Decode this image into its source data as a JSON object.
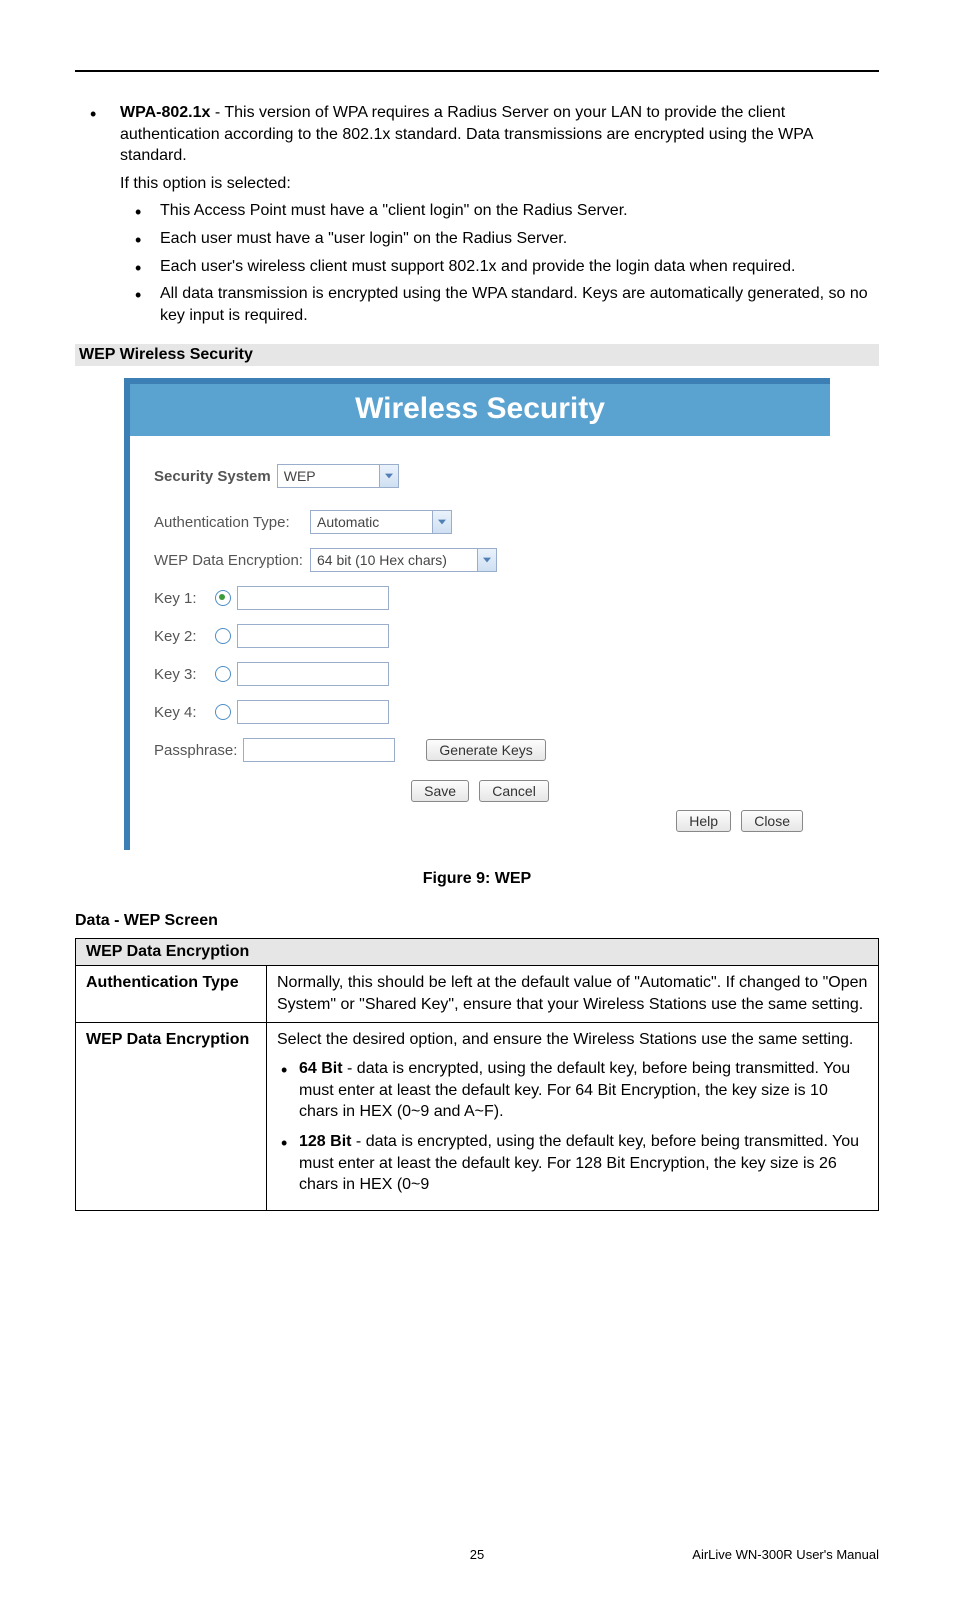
{
  "wpa": {
    "title": "WPA-802.1x",
    "desc": " - This version of WPA requires a Radius Server on your LAN to provide the client authentication according to the 802.1x standard. Data transmissions are encrypted using the WPA standard.",
    "ifselected": "If this option is selected:",
    "items": [
      "This Access Point must have a \"client login\" on the Radius Server.",
      "Each user must have a \"user login\" on the Radius Server.",
      "Each user's wireless client must support 802.1x and provide the login data when required.",
      "All data transmission is encrypted using the WPA standard. Keys are automatically generated, so no key input is required."
    ]
  },
  "section_heading": "WEP Wireless Security",
  "panel": {
    "title": "Wireless Security",
    "security_system_label": "Security System",
    "security_system_value": "WEP",
    "auth_type_label": "Authentication Type:",
    "auth_type_value": "Automatic",
    "wep_enc_label": "WEP Data Encryption:",
    "wep_enc_value": "64 bit (10 Hex chars)",
    "keys": [
      {
        "label": "Key 1:",
        "selected": true
      },
      {
        "label": "Key 2:",
        "selected": false
      },
      {
        "label": "Key 3:",
        "selected": false
      },
      {
        "label": "Key 4:",
        "selected": false
      }
    ],
    "passphrase_label": "Passphrase:",
    "generate_btn": "Generate Keys",
    "save_btn": "Save",
    "cancel_btn": "Cancel",
    "help_btn": "Help",
    "close_btn": "Close"
  },
  "figure_caption": "Figure 9: WEP",
  "table": {
    "heading": "Data - WEP Screen",
    "section_title": "WEP Data Encryption",
    "rows": [
      {
        "label": "Authentication Type",
        "text": "Normally, this should be left at the default value of \"Automatic\". If changed to \"Open System\" or \"Shared Key\", ensure that your Wireless Stations use the same setting."
      },
      {
        "label": "WEP Data Encryption",
        "text": "Select the desired option, and ensure the Wireless Stations use the same setting.",
        "bullets": [
          {
            "bold": "64 Bit",
            "rest": " - data is encrypted, using the default key, before being transmitted. You must enter at least the default key. For 64 Bit Encryption, the key size is 10 chars in HEX (0~9 and A~F)."
          },
          {
            "bold": "128 Bit",
            "rest": " - data is encrypted, using the default key, before being transmitted. You must enter at least the default key. For 128 Bit Encryption, the key size is 26 chars in HEX (0~9"
          }
        ]
      }
    ]
  },
  "footer": {
    "page": "25",
    "product": "AirLive WN-300R User's Manual"
  }
}
